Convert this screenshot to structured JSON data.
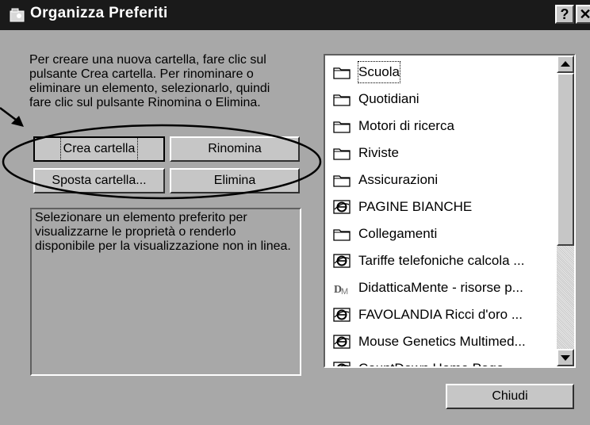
{
  "window": {
    "title": "Organizza Preferiti",
    "help_glyph": "?",
    "close_glyph": "✕"
  },
  "intro_text": "Per creare una nuova cartella, fare clic sul\npulsante Crea cartella. Per rinominare o\neliminare un elemento, selezionarlo, quindi\nfare clic sul pulsante Rinomina o Elimina.",
  "buttons": {
    "create_folder": "Crea cartella",
    "rename": "Rinomina",
    "move_folder": "Sposta cartella...",
    "delete": "Elimina",
    "close": "Chiudi"
  },
  "description_text": "Selezionare un elemento preferito per visualizzarne le proprietà o renderlo disponibile per la visualizzazione non in linea.",
  "favorites": [
    {
      "label": "Scuola",
      "icon": "folder-icon",
      "selected": true
    },
    {
      "label": "Quotidiani",
      "icon": "folder-icon"
    },
    {
      "label": "Motori di ricerca",
      "icon": "folder-icon"
    },
    {
      "label": "Riviste",
      "icon": "folder-icon"
    },
    {
      "label": "Assicurazioni",
      "icon": "folder-icon"
    },
    {
      "label": "PAGINE BIANCHE",
      "icon": "internet-explorer-icon"
    },
    {
      "label": "Collegamenti",
      "icon": "folder-icon"
    },
    {
      "label": "Tariffe telefoniche calcola ...",
      "icon": "internet-explorer-icon"
    },
    {
      "label": "DidatticaMente - risorse p...",
      "icon": "dm-site-icon"
    },
    {
      "label": "FAVOLANDIA Ricci d'oro ...",
      "icon": "internet-explorer-icon"
    },
    {
      "label": "Mouse Genetics  Multimed...",
      "icon": "internet-explorer-icon"
    },
    {
      "label": "CountDown Home Page",
      "icon": "internet-explorer-icon"
    }
  ],
  "colors": {
    "titlebar": "#1a1a1a",
    "dialog_bg": "#a8a8a8",
    "button_face": "#c6c6c6",
    "list_bg": "#ffffff"
  }
}
